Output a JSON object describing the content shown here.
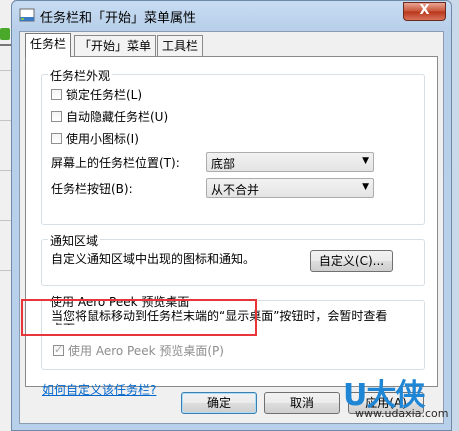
{
  "window": {
    "title": "任务栏和「开始」菜单属性",
    "close_glyph": "X"
  },
  "tabs": [
    {
      "label": "任务栏",
      "active": true
    },
    {
      "label": "「开始」菜单",
      "active": false
    },
    {
      "label": "工具栏",
      "active": false
    }
  ],
  "appearance": {
    "legend": "任务栏外观",
    "lock_label": "锁定任务栏(L)",
    "lock_checked": false,
    "autohide_label": "自动隐藏任务栏(U)",
    "autohide_checked": false,
    "small_icons_label": "使用小图标(I)",
    "small_icons_checked": false,
    "location_label": "屏幕上的任务栏位置(T):",
    "location_value": "底部",
    "buttons_label": "任务栏按钮(B):",
    "buttons_value": "从不合并"
  },
  "notification": {
    "legend": "通知区域",
    "description": "自定义通知区域中出现的图标和通知。",
    "customize_button": "自定义(C)..."
  },
  "aero": {
    "legend": "使用 Aero Peek 预览桌面",
    "description": "当您将鼠标移动到任务栏末端的“显示桌面”按钮时，会暂时查看桌面。",
    "checkbox_label": "使用 Aero Peek 预览桌面(P)",
    "checkbox_checked": true,
    "checkbox_disabled": true
  },
  "help_link": "如何自定义该任务栏?",
  "buttons": {
    "ok": "确定",
    "cancel": "取消",
    "apply": "应用(A)"
  },
  "watermark": {
    "brand": "U大侠",
    "url": "www.udaxia.com"
  },
  "colors": {
    "highlight_box": "#e8353a",
    "link": "#0066cc",
    "brand": "#1f86d6"
  }
}
